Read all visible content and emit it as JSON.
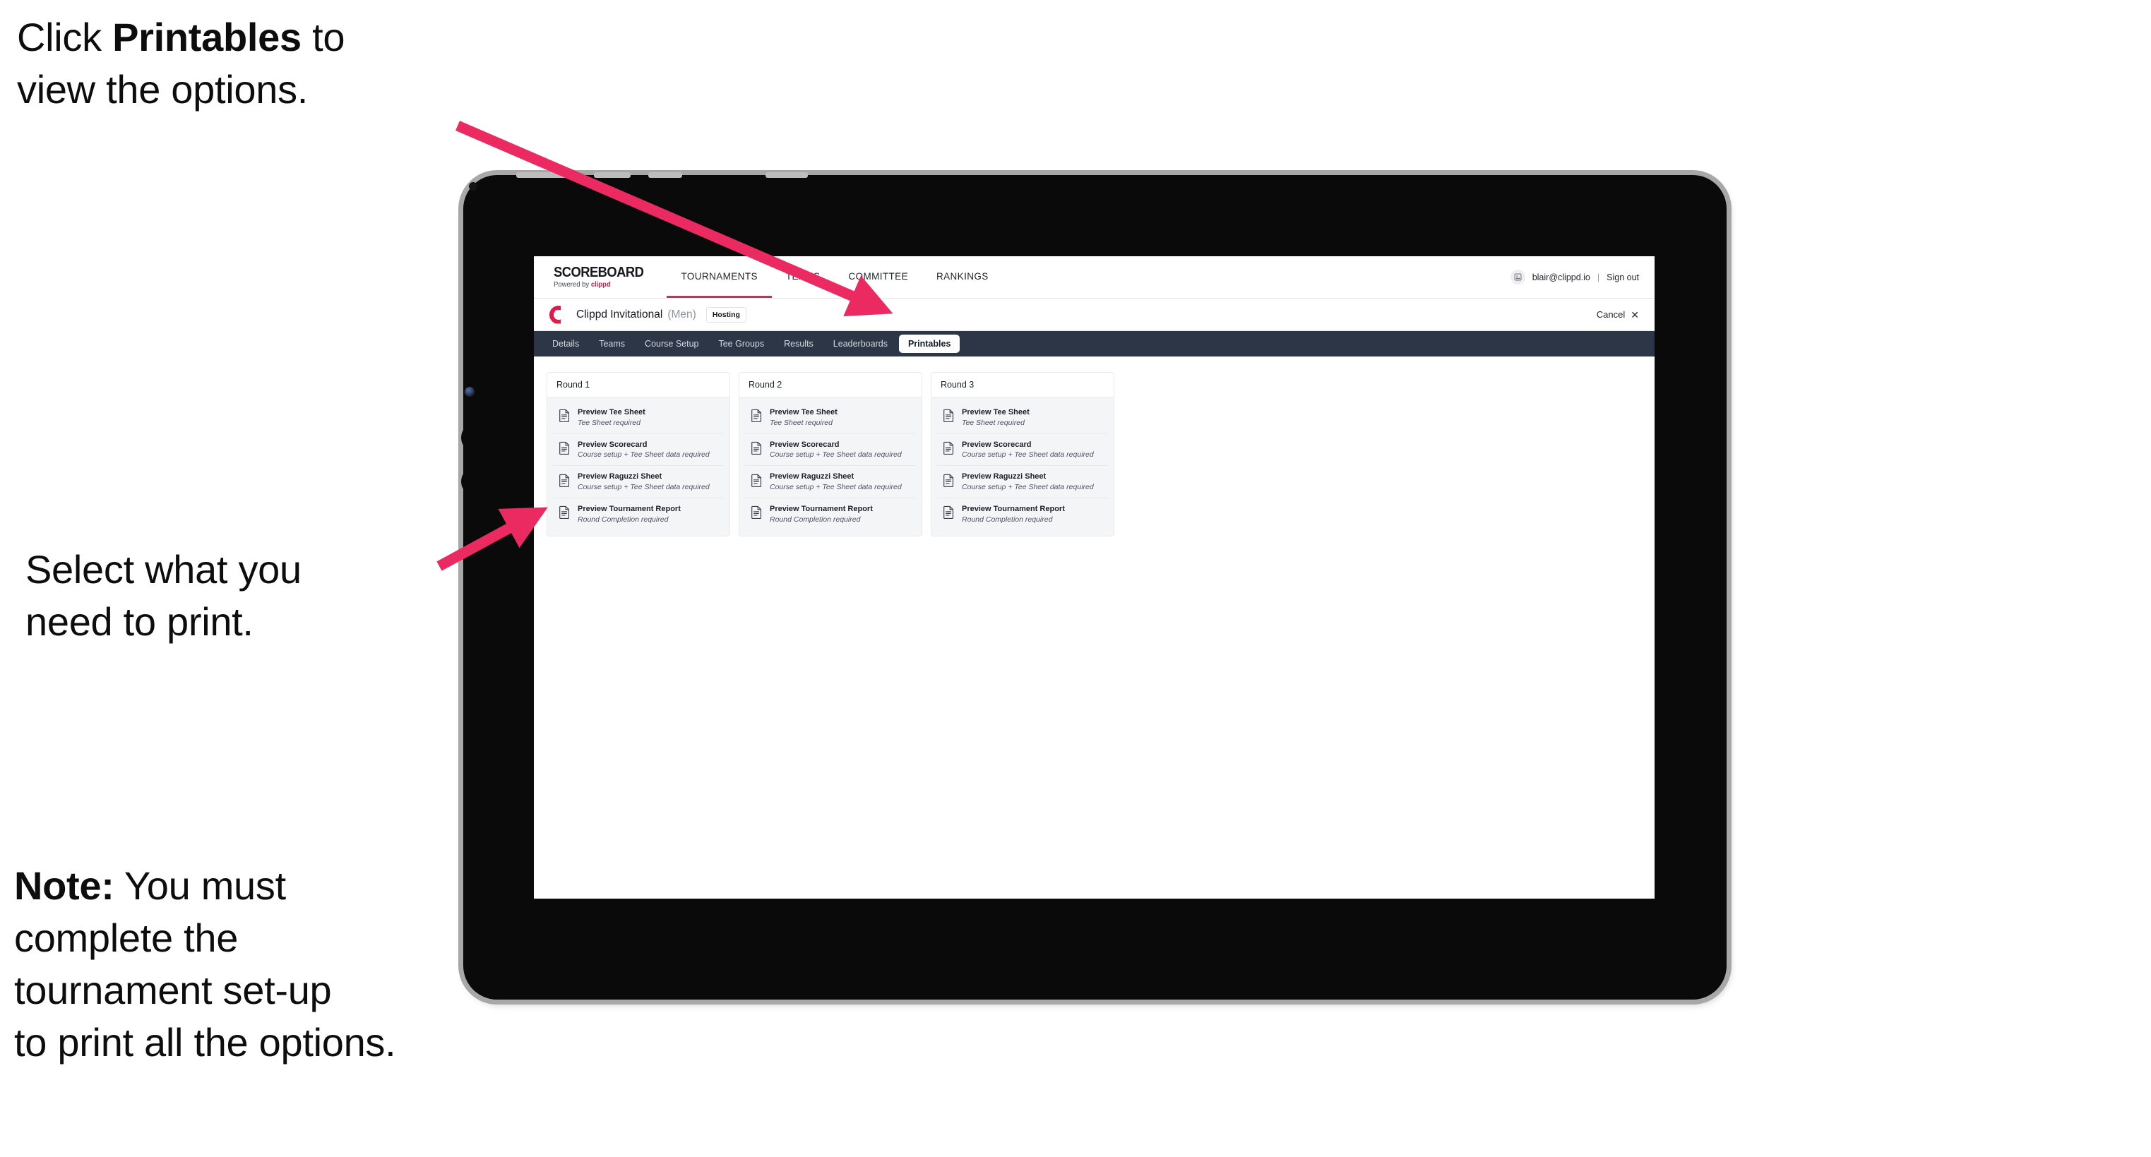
{
  "annotations": [
    {
      "id": "a1",
      "prefix": "Click ",
      "bold": "Printables",
      "suffix": " to\nview the options."
    },
    {
      "id": "a2",
      "prefix": "Select what you\n need to print.",
      "bold": "",
      "suffix": ""
    },
    {
      "id": "a3",
      "prefix": "",
      "bold": "Note:",
      "suffix": " You must\ncomplete the\ntournament set-up\nto print all the options."
    }
  ],
  "colors": {
    "arrow": "#ec2a62",
    "accent_pink": "#e0194e",
    "subtab_bar": "#2c3647",
    "tab_underline": "#c2335a",
    "tablet_body": "#0a0a0a",
    "tablet_edge": "#a8a8a8",
    "card_bg": "#f4f5f7"
  },
  "browser": {
    "topnav": {
      "brand_title": "SCOREBOARD",
      "brand_sub_prefix": "Powered by ",
      "brand_sub_accent": "clippd",
      "links": [
        {
          "label": "TOURNAMENTS",
          "active": true
        },
        {
          "label": "TEAMS",
          "active": false
        },
        {
          "label": "COMMITTEE",
          "active": false
        },
        {
          "label": "RANKINGS",
          "active": false
        }
      ],
      "avatar_icon": "user-avatar-icon",
      "user_email": "blair@clippd.io",
      "separator": "|",
      "sign_out": "Sign out"
    },
    "tournament_bar": {
      "logo_icon": "clippd-c-logo-icon",
      "name": "Clippd Invitational",
      "gender": "(Men)",
      "badge": "Hosting",
      "cancel_label": "Cancel",
      "cancel_icon": "close-x-icon"
    },
    "subtabs": [
      {
        "label": "Details",
        "active": false
      },
      {
        "label": "Teams",
        "active": false
      },
      {
        "label": "Course Setup",
        "active": false
      },
      {
        "label": "Tee Groups",
        "active": false
      },
      {
        "label": "Results",
        "active": false
      },
      {
        "label": "Leaderboards",
        "active": false
      },
      {
        "label": "Printables",
        "active": true
      }
    ],
    "rounds": [
      {
        "title": "Round 1",
        "items": [
          {
            "title": "Preview Tee Sheet",
            "sub": "Tee Sheet required"
          },
          {
            "title": "Preview Scorecard",
            "sub": "Course setup + Tee Sheet data required"
          },
          {
            "title": "Preview Raguzzi Sheet",
            "sub": "Course setup + Tee Sheet data required"
          },
          {
            "title": "Preview Tournament Report",
            "sub": "Round Completion required"
          }
        ]
      },
      {
        "title": "Round 2",
        "items": [
          {
            "title": "Preview Tee Sheet",
            "sub": "Tee Sheet required"
          },
          {
            "title": "Preview Scorecard",
            "sub": "Course setup + Tee Sheet data required"
          },
          {
            "title": "Preview Raguzzi Sheet",
            "sub": "Course setup + Tee Sheet data required"
          },
          {
            "title": "Preview Tournament Report",
            "sub": "Round Completion required"
          }
        ]
      },
      {
        "title": "Round 3",
        "items": [
          {
            "title": "Preview Tee Sheet",
            "sub": "Tee Sheet required"
          },
          {
            "title": "Preview Scorecard",
            "sub": "Course setup + Tee Sheet data required"
          },
          {
            "title": "Preview Raguzzi Sheet",
            "sub": "Course setup + Tee Sheet data required"
          },
          {
            "title": "Preview Tournament Report",
            "sub": "Round Completion required"
          }
        ]
      }
    ]
  }
}
